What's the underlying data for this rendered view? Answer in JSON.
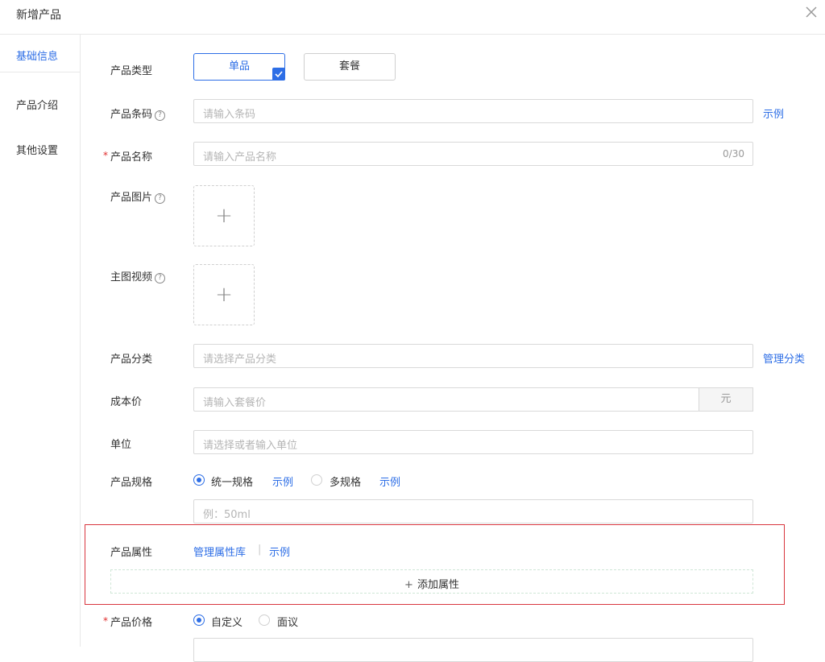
{
  "dialog": {
    "title": "新增产品"
  },
  "sidebar": {
    "tabs": [
      {
        "label": "基础信息"
      },
      {
        "label": "产品介绍"
      },
      {
        "label": "其他设置"
      }
    ]
  },
  "product_type": {
    "label": "产品类型",
    "options": [
      "单品",
      "套餐"
    ],
    "selected": "单品"
  },
  "barcode": {
    "label": "产品条码",
    "placeholder": "请输入条码",
    "example": "示例"
  },
  "name": {
    "required_mark": "*",
    "label": "产品名称",
    "placeholder": "请输入产品名称",
    "counter": "0/30"
  },
  "images": {
    "label": "产品图片"
  },
  "video": {
    "label": "主图视频"
  },
  "category": {
    "label": "产品分类",
    "placeholder": "请选择产品分类",
    "manage": "管理分类"
  },
  "cost": {
    "label": "成本价",
    "placeholder": "请输入套餐价",
    "unit": "元"
  },
  "unit_field": {
    "label": "单位",
    "placeholder": "请选择或者输入单位"
  },
  "spec": {
    "label": "产品规格",
    "opt1": "统一规格",
    "example1": "示例",
    "opt2": "多规格",
    "example2": "示例",
    "placeholder": "例：50ml",
    "selected": "统一规格"
  },
  "attrs": {
    "label": "产品属性",
    "manage": "管理属性库",
    "sep": "|",
    "example": "示例",
    "add": "添加属性"
  },
  "price": {
    "required_mark": "*",
    "label": "产品价格",
    "opt1": "自定义",
    "opt2": "面议",
    "selected": "自定义"
  },
  "colors": {
    "accent": "#2d6ee6",
    "highlight_border": "#d9363e",
    "required": "#e02d2d"
  },
  "icons": [
    "close-icon",
    "help-icon",
    "plus-icon",
    "check-icon",
    "radio-icon"
  ]
}
